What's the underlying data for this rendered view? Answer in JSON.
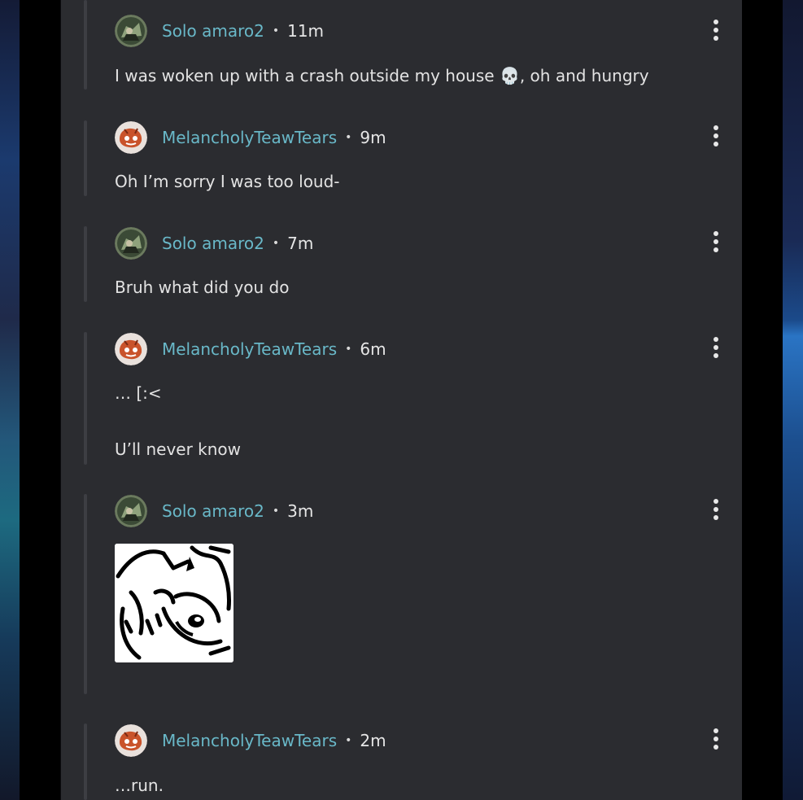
{
  "comments": [
    {
      "user": "Solo amaro2",
      "time": "11m",
      "text": "I was woken up with a crash outside my house 💀, oh and hungry",
      "avatar": "solo-avatar"
    },
    {
      "user": "MelancholyTeawTears",
      "time": "9m",
      "text": "Oh I’m sorry I was too loud-",
      "avatar": "melancholy-avatar"
    },
    {
      "user": "Solo amaro2",
      "time": "7m",
      "text": "Bruh what did you do",
      "avatar": "solo-avatar"
    },
    {
      "user": "MelancholyTeawTears",
      "time": "6m",
      "text": "… [:<",
      "text2": "U’ll never know",
      "avatar": "melancholy-avatar"
    },
    {
      "user": "Solo amaro2",
      "time": "3m",
      "text": "",
      "sticker": "cartoon-sketch-sticker",
      "avatar": "solo-avatar"
    },
    {
      "user": "MelancholyTeawTears",
      "time": "2m",
      "text": "…run.",
      "avatar": "melancholy-avatar"
    }
  ],
  "separator": "•",
  "icons": {
    "menu": "more-vertical-icon"
  },
  "colors": {
    "username": "#69b8c8",
    "panel": "#2b2c30",
    "text": "#e3e3e3"
  }
}
